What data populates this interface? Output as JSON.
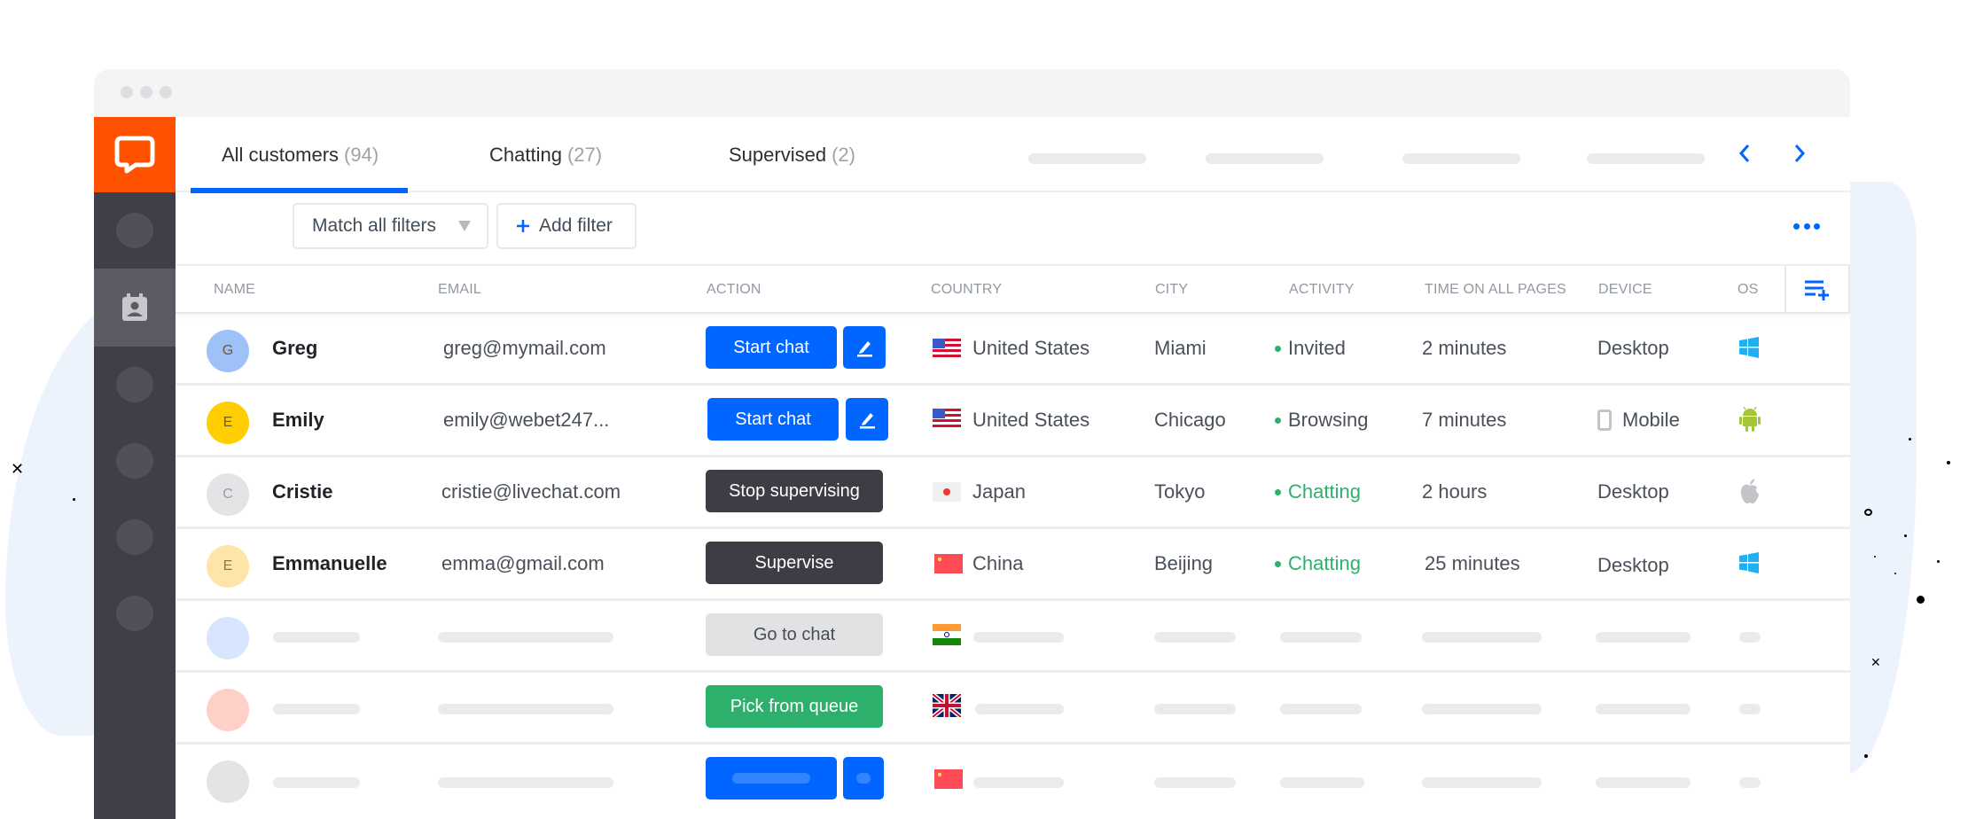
{
  "window": {
    "traffic_lights": 3
  },
  "sidebar": {
    "logo": "livechat-logo-icon",
    "items": [
      {
        "name": "placeholder",
        "active": false
      },
      {
        "name": "customers",
        "icon": "contact-card-icon",
        "active": true
      },
      {
        "name": "placeholder",
        "active": false
      },
      {
        "name": "placeholder",
        "active": false
      },
      {
        "name": "placeholder",
        "active": false
      },
      {
        "name": "placeholder",
        "active": false
      }
    ]
  },
  "tabs": [
    {
      "label": "All customers",
      "count": "(94)",
      "active": true
    },
    {
      "label": "Chatting",
      "count": "(27)",
      "active": false
    },
    {
      "label": "Supervised",
      "count": "(2)",
      "active": false
    }
  ],
  "nav": {
    "prev_icon": "chevron-left-icon",
    "next_icon": "chevron-right-icon"
  },
  "filters": {
    "match_label": "Match all filters",
    "add_label": "Add filter",
    "more_icon": "more-horizontal-icon"
  },
  "columns": [
    "NAME",
    "EMAIL",
    "ACTION",
    "COUNTRY",
    "CITY",
    "ACTIVITY",
    "TIME ON ALL PAGES",
    "DEVICE",
    "OS"
  ],
  "rows": [
    {
      "initial": "G",
      "name": "Greg",
      "email": "greg@mymail.com",
      "action": "Start chat",
      "action_style": "blue",
      "edit": true,
      "flag": "us",
      "country": "United States",
      "city": "Miami",
      "activity": "Invited",
      "time": "2 minutes",
      "device": "Desktop",
      "device_icon": "",
      "os": "windows"
    },
    {
      "initial": "E",
      "name": "Emily",
      "email": "emily@webet247...",
      "action": "Start chat",
      "action_style": "blue",
      "edit": true,
      "flag": "us",
      "country": "United States",
      "city": "Chicago",
      "activity": "Browsing",
      "time": "7 minutes",
      "device": "Mobile",
      "device_icon": "mobile",
      "os": "android"
    },
    {
      "initial": "C",
      "name": "Cristie",
      "email": "cristie@livechat.com",
      "action": "Stop supervising",
      "action_style": "dark",
      "edit": false,
      "flag": "jp",
      "country": "Japan",
      "city": "Tokyo",
      "activity": "Chatting",
      "time": "2 hours",
      "device": "Desktop",
      "device_icon": "",
      "os": "apple"
    },
    {
      "initial": "E",
      "name": "Emmanuelle",
      "email": "emma@gmail.com",
      "action": "Supervise",
      "action_style": "dark",
      "edit": false,
      "flag": "cn",
      "country": "China",
      "city": "Beijing",
      "activity": "Chatting",
      "time": "25 minutes",
      "device": "Desktop",
      "device_icon": "",
      "os": "windows"
    }
  ],
  "placeholder_rows": [
    {
      "action": "Go to chat",
      "action_style": "grey",
      "flag": "in"
    },
    {
      "action": "Pick from queue",
      "action_style": "green",
      "flag": "gb"
    },
    {
      "action": "",
      "action_style": "blue",
      "flag": "cn"
    }
  ],
  "colors": {
    "brand_orange": "#ff5100",
    "accent_blue": "#0066ff",
    "sidebar_dark": "#3e3f47",
    "status_green": "#2db06c",
    "button_dark": "#3d3e45"
  }
}
